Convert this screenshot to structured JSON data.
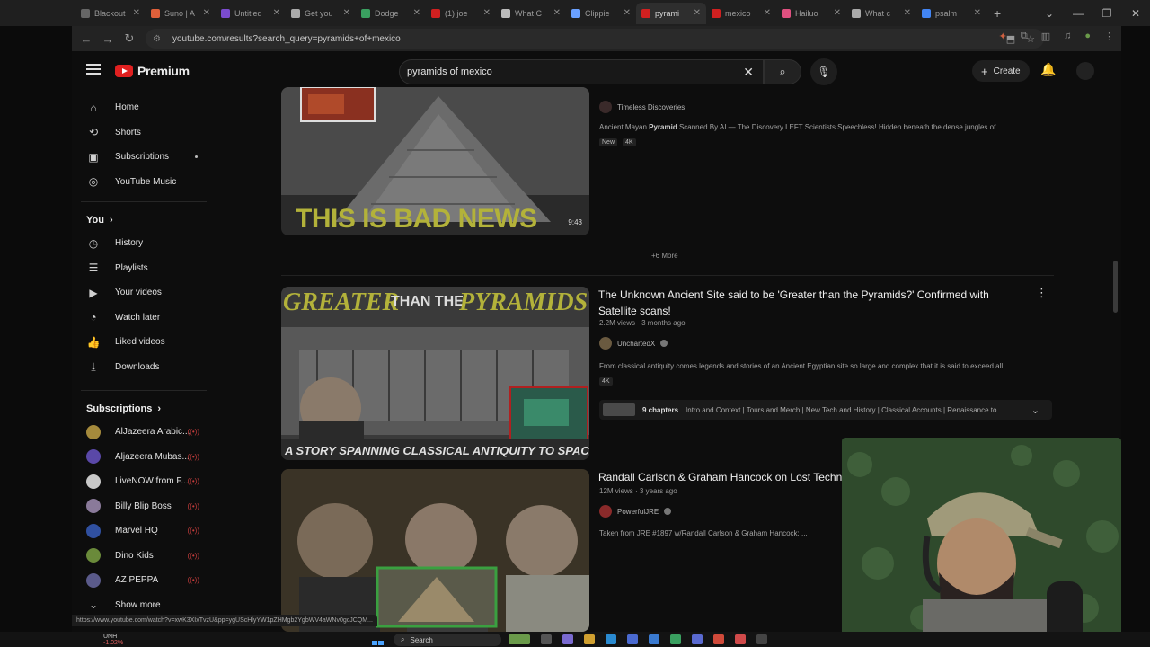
{
  "browser": {
    "tabs": [
      {
        "label": "Blackout",
        "color": "#666"
      },
      {
        "label": "Suno | A",
        "color": "#e0603a"
      },
      {
        "label": "Untitled",
        "color": "#7b4ccf"
      },
      {
        "label": "Get you",
        "color": "#aaa"
      },
      {
        "label": "Dodge",
        "color": "#3aa060"
      },
      {
        "label": "(1) joe",
        "color": "#d02020"
      },
      {
        "label": "What C",
        "color": "#bbb"
      },
      {
        "label": "Clippie",
        "color": "#6aa0ff"
      },
      {
        "label": "pyrami",
        "color": "#d02020",
        "active": true
      },
      {
        "label": "mexico",
        "color": "#d02020"
      },
      {
        "label": "Hailuo",
        "color": "#e05080"
      },
      {
        "label": "What c",
        "color": "#aaa"
      },
      {
        "label": "psalm",
        "color": "#4285f4"
      }
    ],
    "url": "youtube.com/results?search_query=pyramids+of+mexico"
  },
  "header": {
    "logo_text": "Premium",
    "search_value": "pyramids of mexico",
    "create_label": "Create"
  },
  "sidebar": {
    "main": [
      {
        "label": "Home",
        "icon": "home-icon",
        "glyph": "⌂"
      },
      {
        "label": "Shorts",
        "icon": "shorts-icon",
        "glyph": "⟲"
      },
      {
        "label": "Subscriptions",
        "icon": "subscriptions-icon",
        "glyph": "▣"
      },
      {
        "label": "YouTube Music",
        "icon": "music-icon",
        "glyph": "◎"
      }
    ],
    "you_label": "You",
    "you": [
      {
        "label": "History",
        "glyph": "◷"
      },
      {
        "label": "Playlists",
        "glyph": "☰"
      },
      {
        "label": "Your videos",
        "glyph": "▶"
      },
      {
        "label": "Watch later",
        "glyph": "◔"
      },
      {
        "label": "Liked videos",
        "glyph": "👍"
      },
      {
        "label": "Downloads",
        "glyph": "⤓"
      }
    ],
    "subs_label": "Subscriptions",
    "subscriptions": [
      {
        "label": "AlJazeera Arabic...",
        "color": "#a58a3c"
      },
      {
        "label": "Aljazeera Mubas...",
        "color": "#5a48a8"
      },
      {
        "label": "LiveNOW from F...",
        "color": "#c8c8c8"
      },
      {
        "label": "Billy Blip Boss",
        "color": "#8a7a9a"
      },
      {
        "label": "Marvel HQ",
        "color": "#3050a0"
      },
      {
        "label": "Dino Kids",
        "color": "#6a8a3a"
      },
      {
        "label": "AZ PEPPA",
        "color": "#5a5a8a"
      }
    ],
    "show_more": "Show more"
  },
  "results": {
    "first": {
      "channel": "Timeless Discoveries",
      "description_prefix": "Ancient Mayan ",
      "description_bold": "Pyramid",
      "description_rest": " Scanned By AI — The Discovery LEFT Scientists Speechless! Hidden beneath the dense jungles of ...",
      "badges": [
        "New",
        "4K"
      ],
      "thumb_text": "THIS IS BAD NEWS",
      "duration": "9:43",
      "more": "+6 More"
    },
    "second": {
      "title": "The Unknown Ancient Site said to be 'Greater than the Pyramids?' Confirmed with Satellite scans!",
      "meta": "2.2M views · 3 months ago",
      "channel": "UnchartedX",
      "description": "From classical antiquity comes legends and stories of an Ancient Egyptian site so large and complex that it is said to exceed all ...",
      "badge": "4K",
      "chapters_count": "9 chapters",
      "chapters_text": "Intro and Context | Tours and Merch | New Tech and History | Classical Accounts | Renaissance to...",
      "thumb_top_left": "GREATER",
      "thumb_top_mid": "THAN THE",
      "thumb_top_right": "PYRAMIDS?",
      "thumb_bottom": "A STORY SPANNING CLASSICAL ANTIQUITY TO SPACE SCANS"
    },
    "third": {
      "title": "Randall Carlson & Graham Hancock on Lost Techn",
      "meta": "12M views · 3 years ago",
      "channel": "PowerfulJRE",
      "description": "Taken from JRE #1897 w/Randall Carlson & Graham Hancock: ..."
    }
  },
  "status_url": "https://www.youtube.com/watch?v=xwK3XIxTvzU&pp=ygUScHlyYW1pZHMgb2YgbWV4aWNv0gcJCQM...",
  "taskbar": {
    "ticker": "UNH",
    "ticker_change": "-1.02%",
    "search": "Search"
  }
}
